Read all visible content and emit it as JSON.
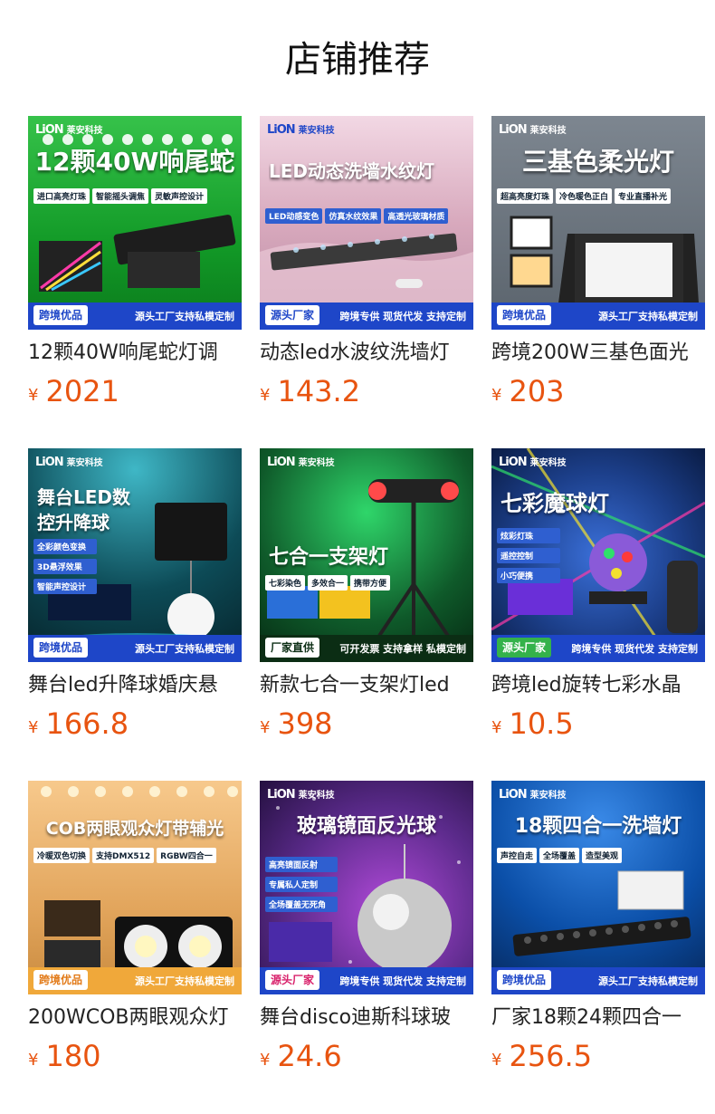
{
  "page": {
    "title": "店铺推荐"
  },
  "products": [
    {
      "name": "12颗40W响尾蛇灯调",
      "currency": "¥",
      "price": "2021",
      "image": {
        "logo_text": "莱安科技",
        "headline": "12颗40W响尾蛇",
        "tags": [
          "进口高亮灯珠",
          "智能摇头调焦",
          "灵敏声控设计"
        ],
        "badge": "跨境优品",
        "bottom_text": "源头工厂支持私模定制",
        "bg": "#1aa32e"
      }
    },
    {
      "name": "动态led水波纹洗墙灯",
      "currency": "¥",
      "price": "143.2",
      "image": {
        "logo_text": "莱安科技",
        "headline": "LED动态洗墙水纹灯",
        "tags": [
          "LED动感变色",
          "仿真水纹效果",
          "高透光玻璃材质"
        ],
        "badge": "源头厂家",
        "bottom_text": "跨境专供 现货代发 支持定制",
        "bg": "#c9a0b4"
      }
    },
    {
      "name": "跨境200W三基色面光",
      "currency": "¥",
      "price": "203",
      "image": {
        "logo_text": "莱安科技",
        "headline": "三基色柔光灯",
        "tags": [
          "超高亮度灯珠",
          "冷色暖色正白",
          "专业直播补光"
        ],
        "badge": "跨境优品",
        "bottom_text": "源头工厂支持私模定制",
        "bg": "#5b6570"
      }
    },
    {
      "name": "舞台led升降球婚庆悬",
      "currency": "¥",
      "price": "166.8",
      "image": {
        "logo_text": "莱安科技",
        "headline": "舞台LED数控升降球",
        "tags": [
          "全彩颜色变换",
          "3D悬浮效果",
          "智能声控设计"
        ],
        "badge": "跨境优品",
        "bottom_text": "源头工厂支持私模定制",
        "bg": "#0d4b57"
      }
    },
    {
      "name": "新款七合一支架灯led",
      "currency": "¥",
      "price": "398",
      "image": {
        "logo_text": "莱安科技",
        "headline": "七合一支架灯",
        "tags": [
          "七彩染色",
          "多效合一",
          "携带方便"
        ],
        "badge": "厂家直供",
        "bottom_text": "可开发票 支持拿样 私模定制",
        "bg": "#0f5a2a"
      }
    },
    {
      "name": "跨境led旋转七彩水晶",
      "currency": "¥",
      "price": "10.5",
      "image": {
        "logo_text": "莱安科技",
        "headline": "七彩魔球灯",
        "tags": [
          "炫彩灯珠",
          "遥控控制",
          "小巧便携"
        ],
        "badge": "源头厂家",
        "bottom_text": "跨境专供 现货代发 支持定制",
        "bg": "#1c3f8a"
      }
    },
    {
      "name": "200WCOB两眼观众灯",
      "currency": "¥",
      "price": "180",
      "image": {
        "logo_text": "",
        "headline": "COB两眼观众灯带辅光",
        "tags": [
          "冷暖双色切换",
          "支持DMX512",
          "RGBW四合一"
        ],
        "badge": "跨境优品",
        "bottom_text": "源头工厂支持私模定制",
        "bg": "#d99a4e"
      }
    },
    {
      "name": "舞台disco迪斯科球玻",
      "currency": "¥",
      "price": "24.6",
      "image": {
        "logo_text": "莱安科技",
        "headline": "玻璃镜面反光球",
        "tags": [
          "高亮镜面反射",
          "专属私人定制",
          "全场覆盖无死角"
        ],
        "badge": "源头厂家",
        "bottom_text": "跨境专供 现货代发 支持定制",
        "bg": "#5a2a8a"
      }
    },
    {
      "name": "厂家18颗24颗四合一",
      "currency": "¥",
      "price": "256.5",
      "image": {
        "logo_text": "莱安科技",
        "headline": "18颗四合一洗墙灯",
        "tags": [
          "声控自走",
          "全场覆盖",
          "造型美观"
        ],
        "badge": "跨境优品",
        "bottom_text": "源头工厂支持私模定制",
        "bg": "#0b4fa8"
      }
    }
  ]
}
